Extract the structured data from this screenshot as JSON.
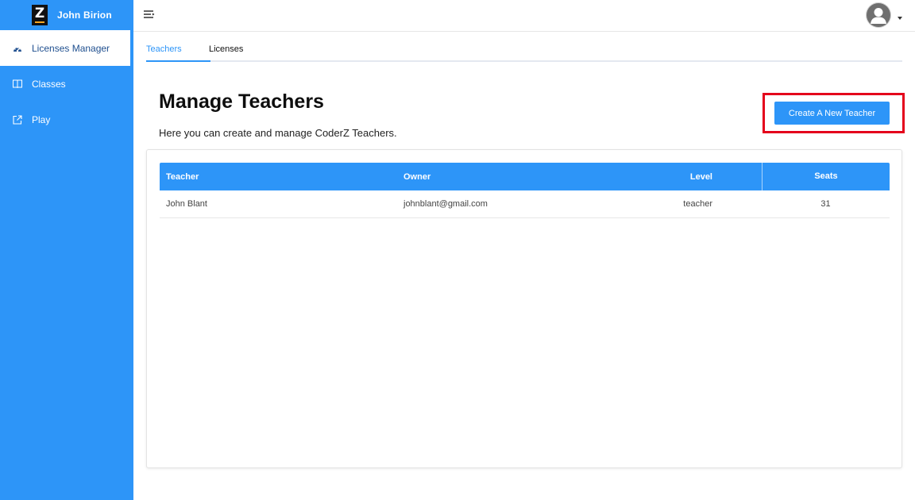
{
  "brand": {
    "logo_letter": "Z",
    "user_name": "John Birion"
  },
  "sidebar": {
    "items": [
      {
        "label": "Licenses Manager",
        "icon": "dashboard-icon",
        "active": true
      },
      {
        "label": "Classes",
        "icon": "book-icon",
        "active": false
      },
      {
        "label": "Play",
        "icon": "external-link-icon",
        "active": false
      }
    ]
  },
  "topbar": {
    "menu_icon": "menu-toggle-icon",
    "avatar_icon": "user-avatar-icon"
  },
  "tabs": [
    {
      "label": "Teachers",
      "active": true
    },
    {
      "label": "Licenses",
      "active": false
    }
  ],
  "main": {
    "title": "Manage Teachers",
    "subtitle": "Here you can create and manage CoderZ Teachers.",
    "create_button_label": "Create A New Teacher"
  },
  "table": {
    "headers": [
      "Teacher",
      "Owner",
      "Level",
      "Seats"
    ],
    "rows": [
      {
        "teacher": "John Blant",
        "owner": "johnblant@gmail.com",
        "level": "teacher",
        "seats": "31"
      }
    ]
  },
  "colors": {
    "accent": "#2d95f8",
    "highlight": "#e4001b"
  }
}
